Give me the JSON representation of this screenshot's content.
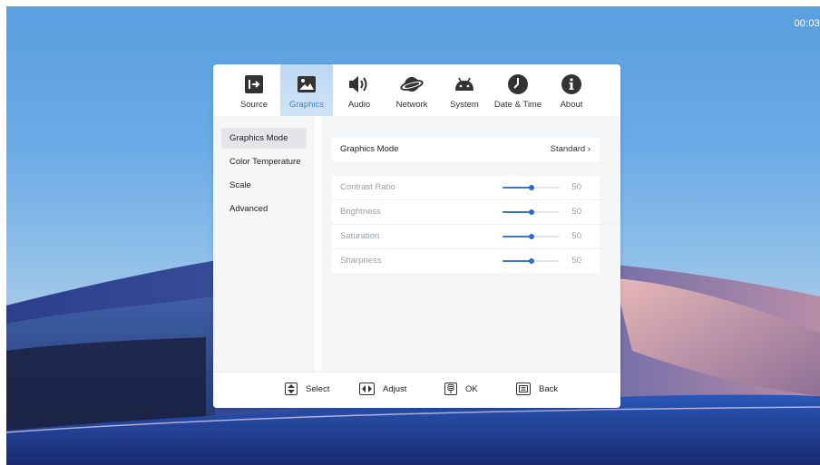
{
  "status": {
    "clock": "00:03"
  },
  "tabs": [
    {
      "label": "Source",
      "icon": "input-arrow-icon"
    },
    {
      "label": "Graphics",
      "icon": "picture-icon",
      "active": true
    },
    {
      "label": "Audio",
      "icon": "speaker-icon"
    },
    {
      "label": "Network",
      "icon": "planet-icon"
    },
    {
      "label": "System",
      "icon": "android-icon"
    },
    {
      "label": "Date & Time",
      "icon": "clock-icon"
    },
    {
      "label": "About",
      "icon": "info-icon"
    }
  ],
  "sidebar": {
    "items": [
      {
        "label": "Graphics Mode",
        "active": true
      },
      {
        "label": "Color Temperature"
      },
      {
        "label": "Scale"
      },
      {
        "label": "Advanced"
      }
    ]
  },
  "main": {
    "mode": {
      "label": "Graphics Mode",
      "value": "Standard",
      "chevron": "›"
    },
    "sliders": [
      {
        "label": "Contrast Ratio",
        "value": "50",
        "level": 50
      },
      {
        "label": "Brightness",
        "value": "50",
        "level": 50
      },
      {
        "label": "Saturation",
        "value": "50",
        "level": 50
      },
      {
        "label": "Sharpness",
        "value": "50",
        "level": 50
      }
    ]
  },
  "footer": {
    "select": "Select",
    "adjust": "Adjust",
    "ok": "OK",
    "back": "Back"
  },
  "colors": {
    "accent": "#3a78c8",
    "active_tab": "#cfe3f6",
    "panel_bg": "#f5f6f8"
  }
}
